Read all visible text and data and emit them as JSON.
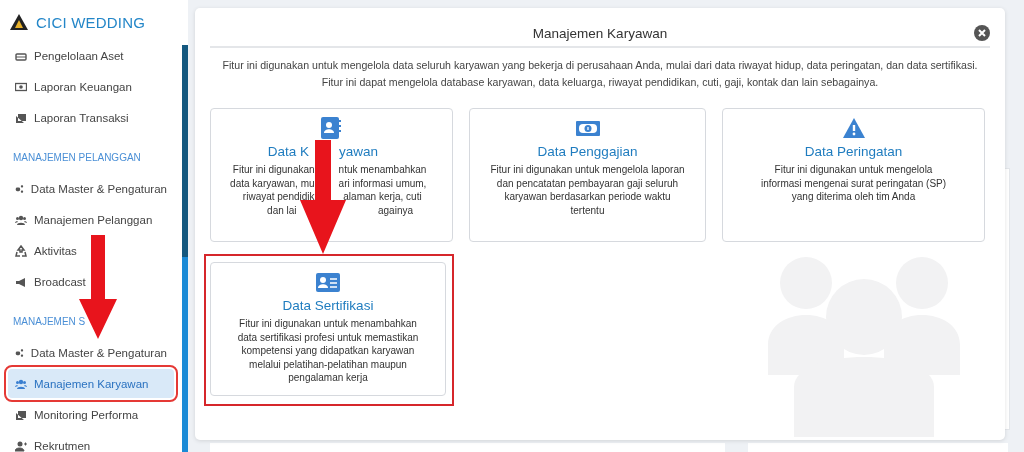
{
  "brand": {
    "name": "CICI WEDDING"
  },
  "sidebar": {
    "groups": [
      {
        "items": [
          {
            "label": "Pengelolaan Aset",
            "selected": false,
            "highlighted": false
          },
          {
            "label": "Laporan Keuangan",
            "selected": false,
            "highlighted": false
          },
          {
            "label": "Laporan Transaksi",
            "selected": false,
            "highlighted": false
          }
        ]
      },
      {
        "heading": "MANAJEMEN PELANGGAN",
        "items": [
          {
            "label": "Data Master & Pengaturan",
            "selected": false,
            "highlighted": false
          },
          {
            "label": "Manajemen Pelanggan",
            "selected": false,
            "highlighted": false
          },
          {
            "label": "Aktivitas",
            "selected": false,
            "highlighted": false
          },
          {
            "label": "Broadcast",
            "selected": false,
            "highlighted": false
          }
        ]
      },
      {
        "heading": "MANAJEMEN S",
        "items": [
          {
            "label": "Data Master & Pengaturan",
            "selected": false,
            "highlighted": false
          },
          {
            "label": "Manajemen Karyawan",
            "selected": true,
            "highlighted": true
          },
          {
            "label": "Monitoring Performa",
            "selected": false,
            "highlighted": false
          },
          {
            "label": "Rekrutmen",
            "selected": false,
            "highlighted": false
          }
        ]
      }
    ]
  },
  "modal": {
    "title": "Manajemen Karyawan",
    "description": "Fitur ini digunakan untuk mengelola data seluruh karyawan yang bekerja di perusahaan Anda, mulai dari data riwayat hidup, data peringatan, dan data sertifikasi. Fitur ini dapat mengelola database karyawan, data keluarga, riwayat pendidikan, cuti, gaji, kontak dan lain sebagainya.",
    "cards": [
      {
        "title": [
          "Data K",
          "yawan"
        ],
        "description": [
          [
            "Fitur ini digunakan",
            "ntuk menambahkan"
          ],
          [
            "data karyawan, mu",
            "ari informasi umum,"
          ],
          [
            "riwayat pendidik",
            "alaman kerja, cuti"
          ],
          [
            "dan lai",
            "againya"
          ]
        ],
        "highlighted": false
      },
      {
        "title": [
          "Data Penggajian"
        ],
        "description": [
          [
            "Fitur ini digunakan untuk mengelola laporan"
          ],
          [
            "dan pencatatan pembayaran gaji seluruh"
          ],
          [
            "karyawan berdasarkan periode waktu"
          ],
          [
            "tertentu"
          ]
        ],
        "highlighted": false
      },
      {
        "title": [
          "Data Peringatan"
        ],
        "description": [
          [
            "Fitur ini digunakan untuk mengelola"
          ],
          [
            "informasi mengenai surat peringatan (SP)"
          ],
          [
            "yang diterima oleh tim Anda"
          ]
        ],
        "highlighted": false
      },
      {
        "title": [
          "Data Sertifikasi"
        ],
        "description": [
          [
            "Fitur ini digunakan untuk menambahkan"
          ],
          [
            "data sertifikasi profesi untuk memastikan"
          ],
          [
            "kompetensi yang didapatkan karyawan"
          ],
          [
            "melalui pelatihan-pelatihan maupun"
          ],
          [
            "pengalaman kerja"
          ]
        ],
        "highlighted": true
      }
    ]
  }
}
